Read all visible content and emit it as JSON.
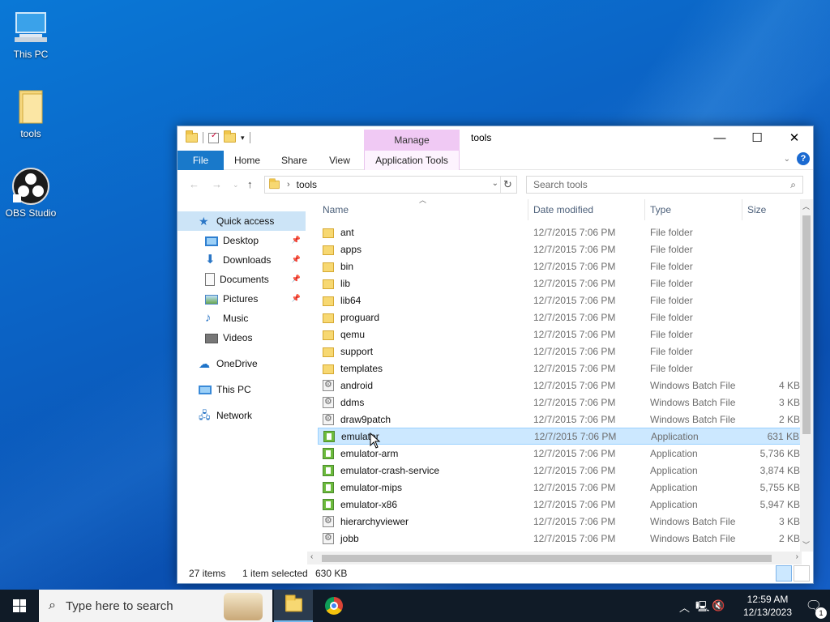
{
  "desktop": {
    "icons": [
      {
        "label": "This PC"
      },
      {
        "label": "tools"
      },
      {
        "label": "OBS Studio"
      }
    ]
  },
  "window": {
    "title": "tools",
    "manage_label": "Manage",
    "ribbon_tabs": [
      "File",
      "Home",
      "Share",
      "View",
      "Application Tools"
    ],
    "address": {
      "path": "tools"
    },
    "search": {
      "placeholder": "Search tools"
    },
    "nav": {
      "quick_access": "Quick access",
      "items": [
        {
          "label": "Desktop",
          "pinned": true
        },
        {
          "label": "Downloads",
          "pinned": true
        },
        {
          "label": "Documents",
          "pinned": true
        },
        {
          "label": "Pictures",
          "pinned": true
        },
        {
          "label": "Music",
          "pinned": false
        },
        {
          "label": "Videos",
          "pinned": false
        }
      ],
      "onedrive": "OneDrive",
      "this_pc": "This PC",
      "network": "Network"
    },
    "columns": {
      "name": "Name",
      "date": "Date modified",
      "type": "Type",
      "size": "Size"
    },
    "files": [
      {
        "name": "ant",
        "date": "12/7/2015 7:06 PM",
        "type": "File folder",
        "size": "",
        "kind": "folder"
      },
      {
        "name": "apps",
        "date": "12/7/2015 7:06 PM",
        "type": "File folder",
        "size": "",
        "kind": "folder"
      },
      {
        "name": "bin",
        "date": "12/7/2015 7:06 PM",
        "type": "File folder",
        "size": "",
        "kind": "folder"
      },
      {
        "name": "lib",
        "date": "12/7/2015 7:06 PM",
        "type": "File folder",
        "size": "",
        "kind": "folder"
      },
      {
        "name": "lib64",
        "date": "12/7/2015 7:06 PM",
        "type": "File folder",
        "size": "",
        "kind": "folder"
      },
      {
        "name": "proguard",
        "date": "12/7/2015 7:06 PM",
        "type": "File folder",
        "size": "",
        "kind": "folder"
      },
      {
        "name": "qemu",
        "date": "12/7/2015 7:06 PM",
        "type": "File folder",
        "size": "",
        "kind": "folder"
      },
      {
        "name": "support",
        "date": "12/7/2015 7:06 PM",
        "type": "File folder",
        "size": "",
        "kind": "folder"
      },
      {
        "name": "templates",
        "date": "12/7/2015 7:06 PM",
        "type": "File folder",
        "size": "",
        "kind": "folder"
      },
      {
        "name": "android",
        "date": "12/7/2015 7:06 PM",
        "type": "Windows Batch File",
        "size": "4 KB",
        "kind": "batch"
      },
      {
        "name": "ddms",
        "date": "12/7/2015 7:06 PM",
        "type": "Windows Batch File",
        "size": "3 KB",
        "kind": "batch"
      },
      {
        "name": "draw9patch",
        "date": "12/7/2015 7:06 PM",
        "type": "Windows Batch File",
        "size": "2 KB",
        "kind": "batch"
      },
      {
        "name": "emulator",
        "date": "12/7/2015 7:06 PM",
        "type": "Application",
        "size": "631 KB",
        "kind": "app",
        "selected": true
      },
      {
        "name": "emulator-arm",
        "date": "12/7/2015 7:06 PM",
        "type": "Application",
        "size": "5,736 KB",
        "kind": "app"
      },
      {
        "name": "emulator-crash-service",
        "date": "12/7/2015 7:06 PM",
        "type": "Application",
        "size": "3,874 KB",
        "kind": "app"
      },
      {
        "name": "emulator-mips",
        "date": "12/7/2015 7:06 PM",
        "type": "Application",
        "size": "5,755 KB",
        "kind": "app"
      },
      {
        "name": "emulator-x86",
        "date": "12/7/2015 7:06 PM",
        "type": "Application",
        "size": "5,947 KB",
        "kind": "app"
      },
      {
        "name": "hierarchyviewer",
        "date": "12/7/2015 7:06 PM",
        "type": "Windows Batch File",
        "size": "3 KB",
        "kind": "batch"
      },
      {
        "name": "jobb",
        "date": "12/7/2015 7:06 PM",
        "type": "Windows Batch File",
        "size": "2 KB",
        "kind": "batch"
      }
    ],
    "status": {
      "count": "27 items",
      "selected": "1 item selected",
      "size": "630 KB"
    }
  },
  "taskbar": {
    "search_placeholder": "Type here to search",
    "time": "12:59 AM",
    "date": "12/13/2023",
    "notifications": "1"
  },
  "colors": {
    "file_tab": "#1979ca",
    "manage_tab": "#f0c9f4",
    "selection": "#cce8ff",
    "taskbar": "#101b27"
  }
}
